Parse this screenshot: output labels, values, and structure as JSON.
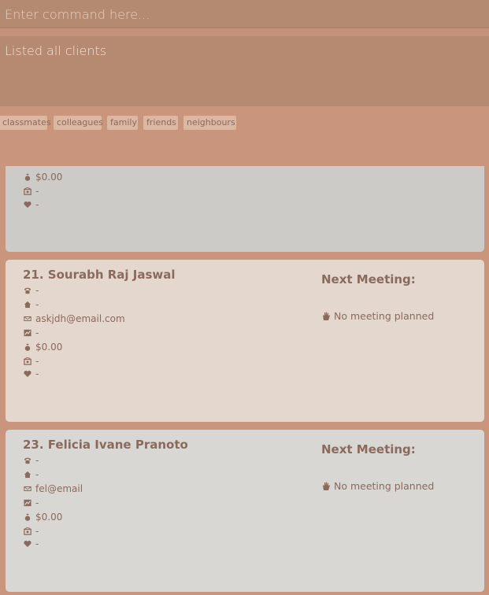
{
  "command": {
    "placeholder": "Enter command here..."
  },
  "result": {
    "text": "Listed all clients"
  },
  "tags": [
    "classmates",
    "colleagues",
    "family",
    "friends",
    "neighbours"
  ],
  "cards": [
    {
      "partial": true,
      "fields": [
        "$0.00",
        "-",
        "-"
      ]
    },
    {
      "title": "21.  Sourabh Raj Jaswal",
      "phone": "-",
      "address": "-",
      "email": "askjdh@email.com",
      "income": "-",
      "money": "$0.00",
      "policy": "-",
      "health": "-",
      "meeting_title": "Next Meeting:",
      "meeting_note": "No meeting planned"
    },
    {
      "title": "23.  Felicia Ivane Pranoto",
      "phone": "-",
      "address": "-",
      "email": "fel@email",
      "income": "-",
      "money": "$0.00",
      "policy": "-",
      "health": "-",
      "meeting_title": "Next Meeting:",
      "meeting_note": "No meeting planned"
    }
  ],
  "icons": [
    "phone-icon",
    "home-icon",
    "email-icon",
    "chart-icon",
    "money-bag-icon",
    "policy-icon",
    "heart-icon",
    "wave-icon"
  ]
}
